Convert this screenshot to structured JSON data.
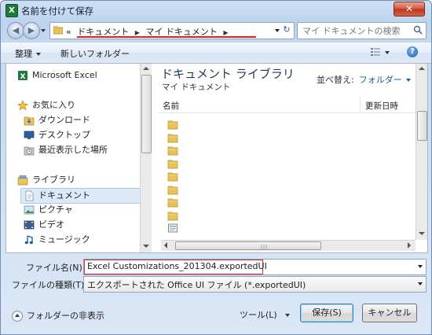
{
  "window": {
    "title": "名前を付けて保存",
    "app_icon_letter": "X",
    "close_symbol": "✕"
  },
  "address": {
    "overflow": "«",
    "segments": [
      "ドキュメント",
      "マイ ドキュメント"
    ],
    "separator": "▶"
  },
  "search": {
    "placeholder": "マイ ドキュメントの検索"
  },
  "toolbar": {
    "organize": "整理",
    "new_folder": "新しいフォルダー",
    "help": "?"
  },
  "nav": {
    "items": [
      {
        "label": "Microsoft Excel",
        "icon": "excel-icon"
      },
      {
        "label": "お気に入り",
        "icon": "star-icon"
      },
      {
        "label": "ダウンロード",
        "icon": "download-folder-icon"
      },
      {
        "label": "デスクトップ",
        "icon": "desktop-icon"
      },
      {
        "label": "最近表示した場所",
        "icon": "recent-places-icon"
      },
      {
        "label": "ライブラリ",
        "icon": "library-icon"
      },
      {
        "label": "ドキュメント",
        "icon": "documents-icon"
      },
      {
        "label": "ピクチャ",
        "icon": "pictures-icon"
      },
      {
        "label": "ビデオ",
        "icon": "videos-icon"
      },
      {
        "label": "ミュージック",
        "icon": "music-icon"
      }
    ]
  },
  "files": {
    "library_title": "ドキュメント ライブラリ",
    "library_subtitle": "マイ ドキュメント",
    "arrange_label": "並べ替え:",
    "arrange_value": "フォルダー",
    "columns": {
      "name": "名前",
      "date": "更新日時"
    },
    "row_icons": [
      "folder-icon",
      "folder-icon",
      "folder-icon",
      "folder-icon",
      "folder-icon",
      "folder-icon",
      "folder-icon",
      "folder-icon",
      "file-icon"
    ]
  },
  "form": {
    "file_name_label": "ファイル名(N):",
    "file_name_value": "Excel Customizations_201304.exportedUI",
    "file_type_label": "ファイルの種類(T):",
    "file_type_value": "エクスポートされた Office UI ファイル (*.exportedUI)"
  },
  "footer": {
    "hide_folders": "フォルダーの非表示",
    "tools": "ツール(L)",
    "save": "保存(S)",
    "cancel": "キャンセル"
  },
  "colors": {
    "accent_red": "#e02020",
    "library_title": "#1e395b",
    "link_blue": "#1a5ea8"
  }
}
